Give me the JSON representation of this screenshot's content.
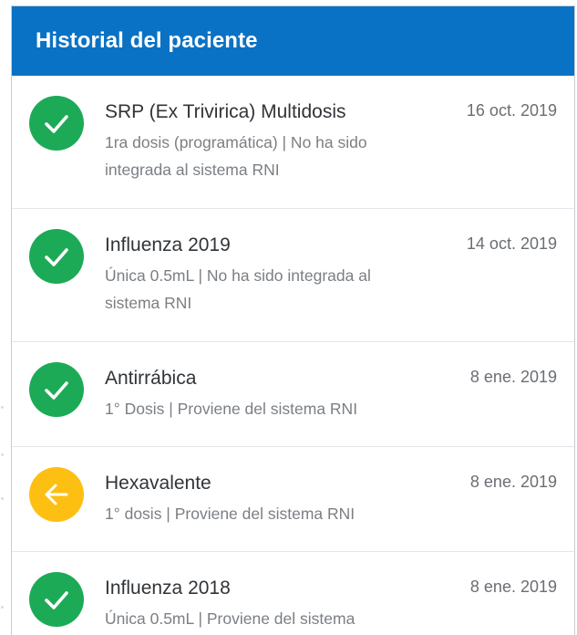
{
  "header": {
    "title": "Historial del paciente"
  },
  "colors": {
    "header_bg": "#0a72c4",
    "status_ok": "#1daa57",
    "status_warn": "#fdbf12"
  },
  "records": [
    {
      "name": "SRP (Ex Trivirica) Multidosis",
      "detail": "1ra dosis (programática) | No ha sido integrada al sistema RNI",
      "date": "16 oct. 2019",
      "status": "ok",
      "icon": "check-circle-icon"
    },
    {
      "name": "Influenza 2019",
      "detail": "Única 0.5mL | No ha sido integrada al sistema RNI",
      "date": "14 oct. 2019",
      "status": "ok",
      "icon": "check-circle-icon"
    },
    {
      "name": "Antirrábica",
      "detail": "1° Dosis | Proviene del sistema RNI",
      "date": "8 ene. 2019",
      "status": "ok",
      "icon": "check-circle-icon"
    },
    {
      "name": "Hexavalente",
      "detail": "1° dosis | Proviene del sistema RNI",
      "date": "8 ene. 2019",
      "status": "warn",
      "icon": "arrow-left-circle-icon"
    },
    {
      "name": "Influenza 2018",
      "detail": "Única 0.5mL | Proviene del sistema",
      "date": "8 ene. 2019",
      "status": "ok",
      "icon": "check-circle-icon"
    }
  ]
}
